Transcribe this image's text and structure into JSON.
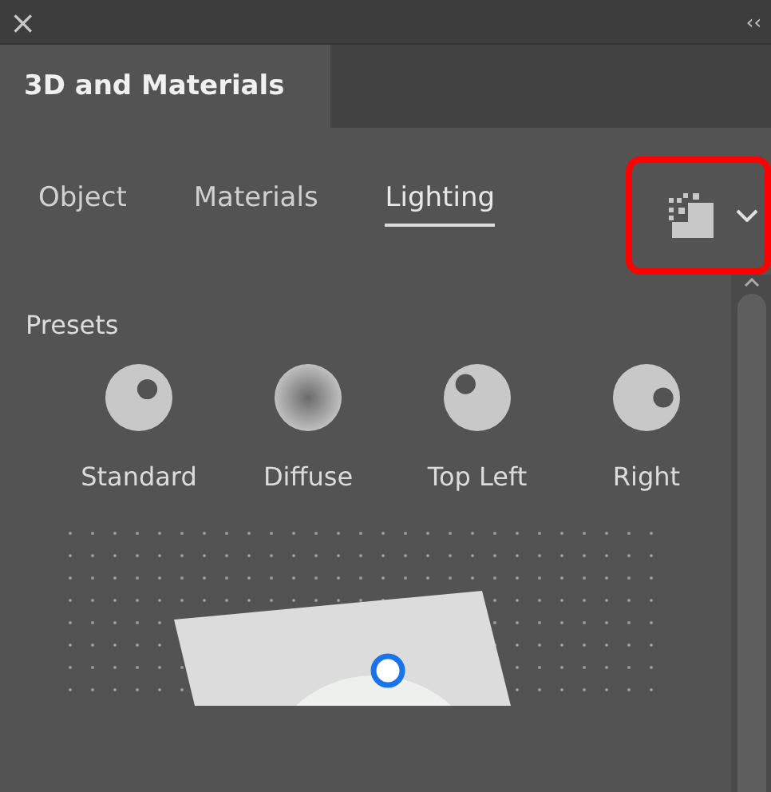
{
  "title_bar": {
    "close": "×",
    "collapse": "‹‹"
  },
  "panel_tabs": [
    {
      "label": "3D and Materials",
      "selected": true
    }
  ],
  "sub_tabs": [
    {
      "label": "Object",
      "selected": false
    },
    {
      "label": "Materials",
      "selected": false
    },
    {
      "label": "Lighting",
      "selected": true
    }
  ],
  "render_menu": {
    "highlighted": true
  },
  "presets": {
    "heading": "Presets",
    "items": [
      {
        "kind": "standard",
        "label": "Standard"
      },
      {
        "kind": "diffuse",
        "label": "Diffuse"
      },
      {
        "kind": "top_left",
        "label": "Top Left"
      },
      {
        "kind": "right",
        "label": "Right"
      }
    ]
  }
}
